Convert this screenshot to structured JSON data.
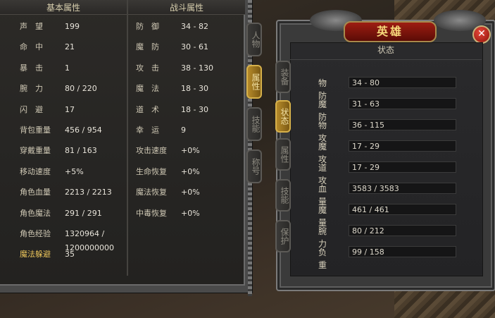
{
  "left_panel": {
    "header_basic": "基本属性",
    "header_combat": "战斗属性",
    "basic_stats": [
      {
        "label": "声　望",
        "value": "199"
      },
      {
        "label": "命　中",
        "value": "21"
      },
      {
        "label": "暴　击",
        "value": "1"
      },
      {
        "label": "腕　力",
        "value": "80 / 220"
      },
      {
        "label": "闪　避",
        "value": "17"
      },
      {
        "label": "背包重量",
        "value": "456 / 954"
      },
      {
        "label": "穿戴重量",
        "value": "81 / 163"
      },
      {
        "label": "移动速度",
        "value": "+5%"
      },
      {
        "label": "角色血量",
        "value": "2213 / 2213"
      },
      {
        "label": "角色魔法",
        "value": "291 / 291"
      },
      {
        "label": "角色经验",
        "value": "1320964 / 1200000000"
      },
      {
        "label": "魔法躲避",
        "value": "35"
      }
    ],
    "combat_stats": [
      {
        "label": "防　御",
        "value": "34 - 82"
      },
      {
        "label": "魔　防",
        "value": "30 - 61"
      },
      {
        "label": "攻　击",
        "value": "38 - 130"
      },
      {
        "label": "魔　法",
        "value": "18 - 30"
      },
      {
        "label": "道　术",
        "value": "18 - 30"
      },
      {
        "label": "幸　运",
        "value": "9"
      },
      {
        "label": "攻击速度",
        "value": "+0%"
      },
      {
        "label": "生命恢复",
        "value": "+0%"
      },
      {
        "label": "魔法恢复",
        "value": "+0%"
      },
      {
        "label": "中毒恢复",
        "value": "+0%"
      }
    ],
    "tabs": [
      {
        "label": "人物",
        "active": false
      },
      {
        "label": "属性",
        "active": true
      },
      {
        "label": "技能",
        "active": false
      },
      {
        "label": "称号",
        "active": false
      }
    ]
  },
  "right_panel": {
    "title": "英雄",
    "close_icon": "close-icon",
    "status_title": "状态",
    "stats": [
      {
        "label": "物防",
        "value": "34 - 80"
      },
      {
        "label": "魔防",
        "value": "31 - 63"
      },
      {
        "label": "物攻",
        "value": "36 - 115"
      },
      {
        "label": "魔攻",
        "value": "17 - 29"
      },
      {
        "label": "道攻",
        "value": "17 - 29"
      },
      {
        "label": "血量",
        "value": "3583 / 3583"
      },
      {
        "label": "魔量",
        "value": "461 / 461"
      },
      {
        "label": "腕力",
        "value": "80 / 212"
      },
      {
        "label": "负重",
        "value": "99 / 158"
      }
    ],
    "tabs": [
      {
        "label": "装备",
        "active": false
      },
      {
        "label": "状态",
        "active": true
      },
      {
        "label": "属性",
        "active": false
      },
      {
        "label": "技能",
        "active": false
      },
      {
        "label": "保护",
        "active": false
      }
    ]
  },
  "colors": {
    "active_tab": "#b58a2a",
    "title_red": "#9e1d12",
    "gold_label": "#e9c35a"
  }
}
